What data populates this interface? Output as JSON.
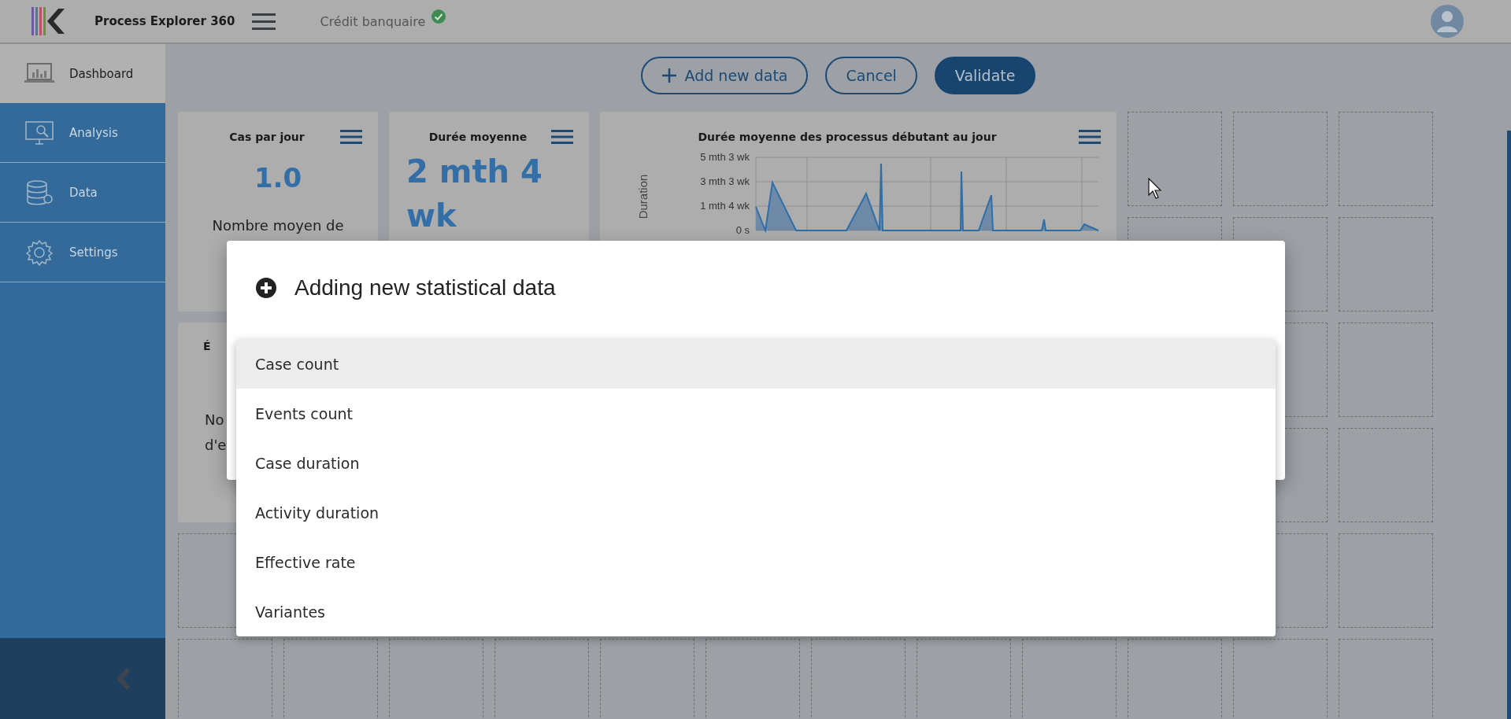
{
  "header": {
    "app_name": "Process Explorer 360",
    "project": "Crédit banquaire",
    "project_ok": true
  },
  "sidebar": {
    "items": [
      {
        "label": "Dashboard",
        "selected": true
      },
      {
        "label": "Analysis",
        "selected": false
      },
      {
        "label": "Data",
        "selected": false
      },
      {
        "label": "Settings",
        "selected": false
      }
    ]
  },
  "toolbar": {
    "buttons": [
      {
        "label": "Add new data",
        "kind": "add"
      },
      {
        "label": "Cancel",
        "kind": "outline"
      },
      {
        "label": "Validate",
        "kind": "primary"
      }
    ]
  },
  "cards": [
    {
      "kind": "kpi",
      "title": "Cas par jour",
      "value": "1.0",
      "description": "Nombre moyen de"
    },
    {
      "kind": "kpi",
      "title": "Durée moyenne",
      "value": "2 mth 4 wk"
    },
    {
      "kind": "chart",
      "title": "Durée moyenne des processus débutant au jour",
      "y_axis_title": "Duration",
      "y_tick_labels": [
        "5 mth 3 wk",
        "3 mth 3 wk",
        "1 mth 4 wk",
        "0 s"
      ]
    },
    {
      "kind": "partial",
      "title": "É",
      "description_lines": [
        "No",
        "d'e"
      ]
    }
  ],
  "dialog": {
    "title": "Adding new statistical data",
    "options": [
      {
        "label": "Case count",
        "selected": true
      },
      {
        "label": "Events count",
        "selected": false
      },
      {
        "label": "Case duration",
        "selected": false
      },
      {
        "label": "Activity duration",
        "selected": false
      },
      {
        "label": "Effective rate",
        "selected": false
      },
      {
        "label": "Variantes",
        "selected": false
      }
    ]
  }
}
